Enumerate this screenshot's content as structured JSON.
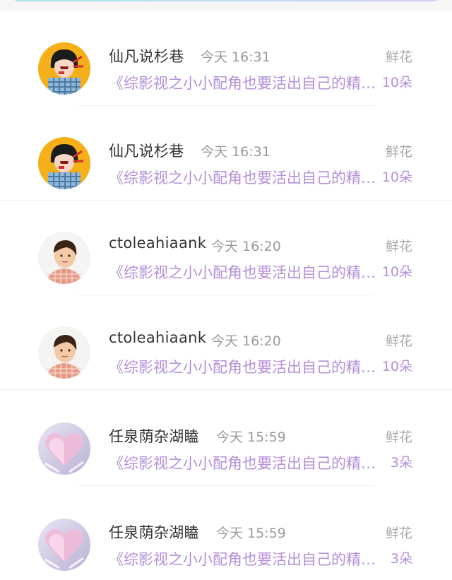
{
  "items": [
    {
      "name": "仙凡说杉巷",
      "time": "今天 16:31",
      "book": "《综影视之小小配角也要活出自己的精彩》",
      "gift_type": "鲜花",
      "gift_count": "10朵",
      "avatar": "girl-avatar"
    },
    {
      "name": "仙凡说杉巷",
      "time": "今天 16:31",
      "book": "《综影视之小小配角也要活出自己的精彩》",
      "gift_type": "鲜花",
      "gift_count": "10朵",
      "avatar": "girl-avatar"
    },
    {
      "name": "ctoleahiaank",
      "time": "今天 16:20",
      "book": "《综影视之小小配角也要活出自己的精彩》",
      "gift_type": "鲜花",
      "gift_count": "10朵",
      "avatar": "boy-avatar"
    },
    {
      "name": "ctoleahiaank",
      "time": "今天 16:20",
      "book": "《综影视之小小配角也要活出自己的精彩》",
      "gift_type": "鲜花",
      "gift_count": "10朵",
      "avatar": "boy-avatar"
    },
    {
      "name": "任泉荫杂湖瞌",
      "time": "今天 15:59",
      "book": "《综影视之小小配角也要活出自己的精彩》",
      "gift_type": "鲜花",
      "gift_count": "3朵",
      "avatar": "heart-avatar"
    },
    {
      "name": "任泉荫杂湖瞌",
      "time": "今天 15:59",
      "book": "《综影视之小小配角也要活出自己的精彩》",
      "gift_type": "鲜花",
      "gift_count": "3朵",
      "avatar": "heart-avatar"
    }
  ],
  "colors": {
    "book_title": "#b38fd9",
    "gift_count": "#b38fd9",
    "name": "#333333",
    "time": "#9a9a9a"
  }
}
